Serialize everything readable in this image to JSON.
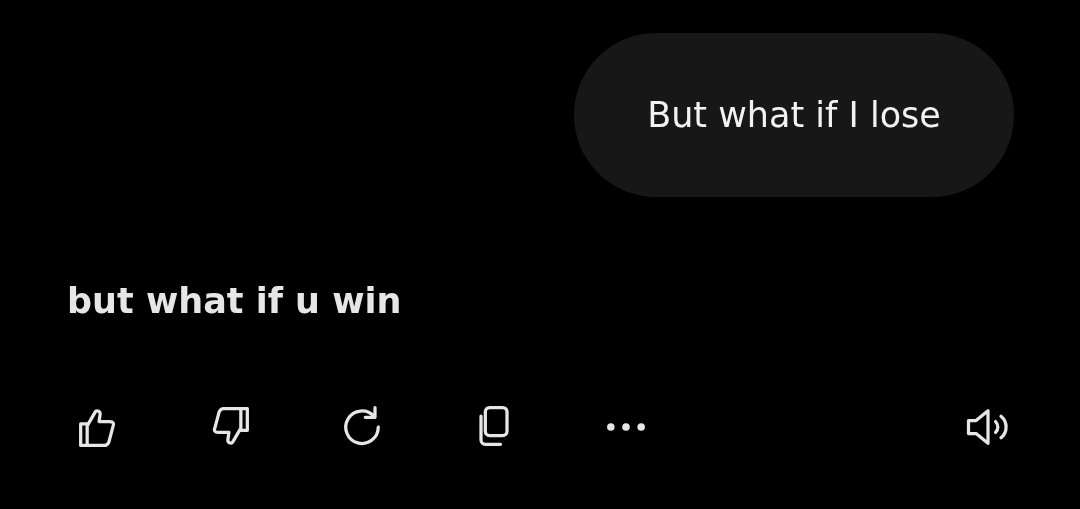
{
  "user_message": {
    "text": "But what if I lose"
  },
  "assistant_message": {
    "text": "but what if u win"
  }
}
